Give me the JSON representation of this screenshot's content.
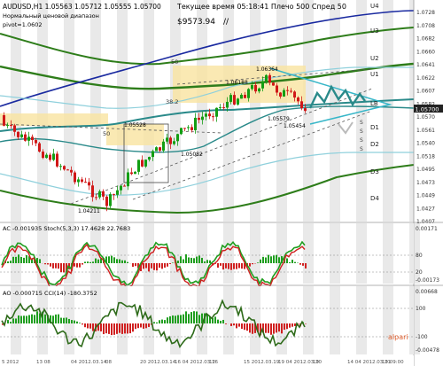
{
  "header": {
    "symbol_line": "AUDUSD,H1  1.05563 1.05712 1.05555 1.05700",
    "subtitle": "Нормальный ценовой диапазон",
    "pivot_line": "pivot=1.0602",
    "server_time_label": "Текущее время 05:18:41 Плечо 500 Спред 50",
    "balance": "$9573.94",
    "balance_suffix": "//"
  },
  "price_scale": {
    "ticks": [
      "1.0728",
      "1.0708",
      "1.0682",
      "1.0660",
      "1.0641",
      "1.0622",
      "1.0607",
      "1.0582",
      "1.0570",
      "1.0561",
      "1.0540",
      "1.0518",
      "1.0495",
      "1.0473",
      "1.0449",
      "1.0427",
      "1.0407"
    ],
    "current_price": "1.05700"
  },
  "levels": {
    "right": [
      "U4",
      "U3",
      "U2",
      "U1",
      "LB",
      "D1",
      "D2",
      "D3",
      "D4"
    ],
    "left": [
      "S",
      "S",
      "S",
      "S"
    ]
  },
  "annotations": {
    "price_labels": [
      "1.06364",
      "1.06188",
      "1.05528",
      "1.05579",
      "1.05454",
      "1.05082",
      "1.04211",
      "1.05700"
    ],
    "fibo_labels": [
      "50",
      "38.2",
      "50"
    ]
  },
  "stoch_panel": {
    "label": "AC -0.001935  Stoch(5,3,3) 17.4628 22.7683",
    "scale": [
      "0.00171",
      "80",
      "20",
      "-0.00173"
    ]
  },
  "ao_panel": {
    "label": "AO -0.000715  CCI(14) -180.3752",
    "scale": [
      "0.00668",
      "100",
      "-100",
      "-0.00478"
    ]
  },
  "time_axis": {
    "labels": [
      "5 2012",
      "13 08",
      "04 2012.03.14",
      "08",
      "20 2012.03.14",
      "16 04 2012.03.16",
      "12",
      "15 2012.03.19",
      "19 04 2012.03.20",
      "19",
      "14 04 2012.03.21",
      "19 09:00"
    ]
  },
  "watermark": "alpari",
  "colors": {
    "background": "#ffffff",
    "grid_stripe": "#d7d7d7",
    "bull_candle": "#139e13",
    "bear_candle": "#d01818",
    "zone": "#f9e3a0",
    "ma_green": "#2e7d1a",
    "ma_teal": "#2a8a8a",
    "ma_navy": "#1a2aa0",
    "triangle": "#37b6c8"
  }
}
